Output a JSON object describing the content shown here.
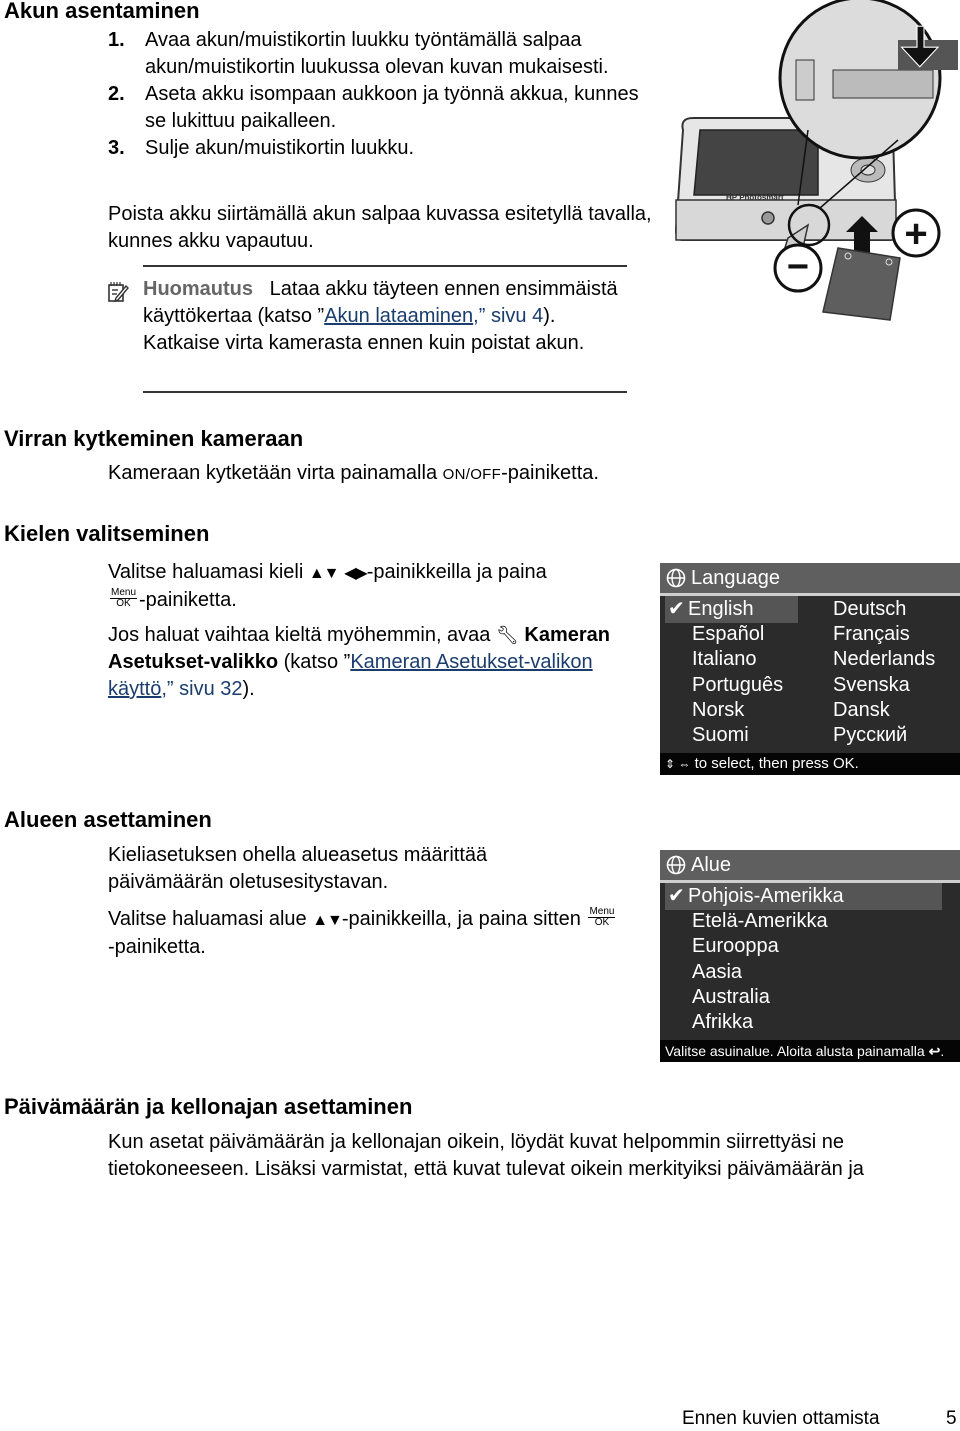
{
  "sections": {
    "battery": {
      "heading": "Akun asentaminen",
      "steps": [
        {
          "num": "1.",
          "text": "Avaa akun/muistikortin luukku työntämällä salpaa akun/muistikortin luukussa olevan kuvan mukaisesti."
        },
        {
          "num": "2.",
          "text": "Aseta akku isompaan aukkoon ja työnnä akkua, kunnes se lukittuu paikalleen."
        },
        {
          "num": "3.",
          "text": "Sulje akun/muistikortin luukku."
        }
      ],
      "remove_text": "Poista akku siirtämällä akun salpaa kuvassa esitetyllä tavalla, kunnes akku vapautuu.",
      "note": {
        "icon": "note-pencil-icon",
        "label": "Huomautus",
        "text_before": "Lataa akku täyteen ennen ensimmäistä käyttökertaa (katso ”",
        "link_text": "Akun lataaminen",
        "text_ref": ",” sivu 4",
        "text_after": "). Katkaise virta kamerasta ennen kuin poistat akun."
      },
      "illustration": {
        "brand_label": "HP Photosmart",
        "minus_symbol": "−",
        "plus_symbol": "+"
      }
    },
    "power": {
      "heading": "Virran kytkeminen kameraan",
      "text_before": "Kameraan kytketään virta painamalla ",
      "button_label": "ON/OFF",
      "text_after": "-painiketta."
    },
    "language": {
      "heading": "Kielen valitseminen",
      "p1_before": "Valitse haluamasi kieli ",
      "p1_arrows_updown": "▲▼",
      "p1_arrows_leftright": "◀▶",
      "p1_mid": "-painikkeilla ja paina ",
      "menu_top": "Menu",
      "menu_bottom": "OK",
      "p1_after": "-painiketta.",
      "p2_before": "Jos haluat vaihtaa kieltä myöhemmin, avaa ",
      "p2_icon": "wrench-icon",
      "p2_bold": "Kameran Asetukset-valikko",
      "p2_mid": " (katso ”",
      "p2_link": "Kameran Asetukset-valikon käyttö",
      "p2_ref": ",” sivu 32",
      "p2_after": ").",
      "screen": {
        "title": "Language",
        "selected": "English",
        "left_column": [
          "English",
          "Español",
          "Italiano",
          "Português",
          "Norsk",
          "Suomi"
        ],
        "right_column": [
          "Deutsch",
          "Français",
          "Nederlands",
          "Svenska",
          "Dansk",
          "Русский"
        ],
        "footer_icons": "⇕ ⇔",
        "footer_text": "to select, then press OK."
      }
    },
    "region": {
      "heading": "Alueen asettaminen",
      "p1": "Kieliasetuksen ohella alueasetus määrittää päivämäärän oletusesitystavan.",
      "p2_before": "Valitse haluamasi alue ",
      "p2_arrows": "▲▼",
      "p2_mid": "-painikkeilla, ja paina sitten ",
      "menu_top": "Menu",
      "menu_bottom": "OK",
      "p2_after": "-painiketta.",
      "screen": {
        "title": "Alue",
        "selected": "Pohjois-Amerikka",
        "items": [
          "Pohjois-Amerikka",
          "Etelä-Amerikka",
          "Eurooppa",
          "Aasia",
          "Australia",
          "Afrikka"
        ],
        "footer_text": "Valitse asuinalue. Aloita alusta painamalla",
        "footer_icon": "↩",
        "footer_end": "."
      }
    },
    "datetime": {
      "heading": "Päivämäärän ja kellonajan asettaminen",
      "text": "Kun asetat päivämäärän ja kellonajan oikein, löydät kuvat helpommin siirrettyäsi ne tietokoneeseen. Lisäksi varmistat, että kuvat tulevat oikein merkityiksi päivämäärän ja"
    }
  },
  "footer": {
    "chapter": "Ennen kuvien ottamista",
    "page": "5"
  }
}
